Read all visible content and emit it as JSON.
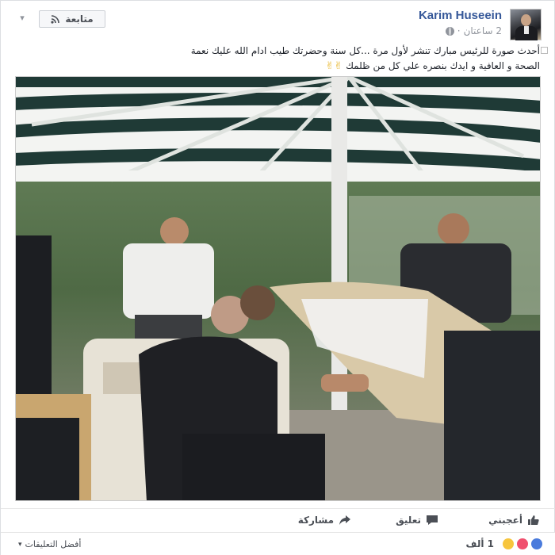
{
  "header": {
    "author": "Karim Huseein",
    "time": "2 ساعتان",
    "separator": "·",
    "follow_label": "متابعة",
    "menu_icon": "chevron-down-icon",
    "privacy_icon": "globe-icon"
  },
  "post": {
    "line1": "أحدث صورة للرئيس مبارك تنشر لأول مرة ...كل سنة وحضرتك طيب ادام الله عليك نعمة",
    "line2": "الصحة و العافية و ايدك بنصره علي كل من ظلمك",
    "emoji_label": "✌✌"
  },
  "photo": {
    "description_icon": "post-photo"
  },
  "actions": {
    "like_label": "أعجبني",
    "comment_label": "تعليق",
    "share_label": "مشاركة"
  },
  "footer": {
    "reaction_count": "1 ألف",
    "sort_label": "أفضل التعليقات"
  },
  "colors": {
    "link": "#365899",
    "muted": "#90949c",
    "like_blue": "#4a7bdc",
    "love_red": "#f0506e",
    "haha_yellow": "#f7c53d"
  }
}
